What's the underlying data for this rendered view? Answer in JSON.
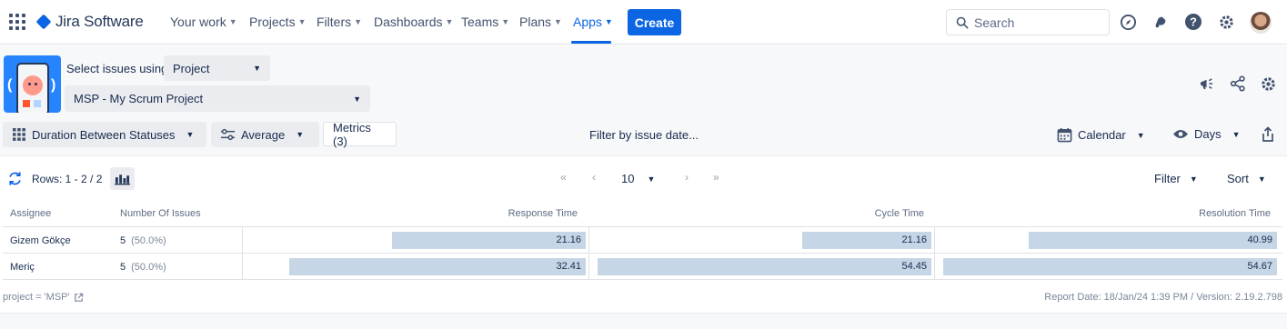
{
  "nav": {
    "brand": "Jira Software",
    "items": [
      {
        "label": "Your work"
      },
      {
        "label": "Projects"
      },
      {
        "label": "Filters"
      },
      {
        "label": "Dashboards"
      },
      {
        "label": "Teams"
      },
      {
        "label": "Plans"
      },
      {
        "label": "Apps",
        "active": true
      }
    ],
    "create_label": "Create",
    "search_placeholder": "Search",
    "accent_color": "#0c66e4"
  },
  "header": {
    "select_label": "Select issues using",
    "select_type": "Project",
    "project": "MSP - My Scrum Project"
  },
  "toolbar": {
    "report_type": "Duration Between Statuses",
    "aggregation": "Average",
    "metrics": "Metrics (3)",
    "filter_date": "Filter by issue date...",
    "calendar": "Calendar",
    "time_unit": "Days"
  },
  "rows_bar": {
    "rows_text": "Rows: 1 - 2 / 2",
    "page_size": "10",
    "filter": "Filter",
    "sort": "Sort"
  },
  "table": {
    "columns": [
      "Assignee",
      "Number Of Issues",
      "Response Time",
      "Cycle Time",
      "Resolution Time"
    ],
    "rows": [
      {
        "assignee": "Gizem Gökçe",
        "issues": "5",
        "pct": "(50.0%)",
        "response": "21.16",
        "response_frac": 0.567,
        "cycle": "21.16",
        "cycle_frac": 0.381,
        "resolution": "40.99",
        "resolution_frac": 0.73
      },
      {
        "assignee": "Meriç",
        "issues": "5",
        "pct": "(50.0%)",
        "response": "32.41",
        "response_frac": 0.868,
        "cycle": "54.45",
        "cycle_frac": 0.98,
        "resolution": "54.67",
        "resolution_frac": 0.98
      }
    ]
  },
  "footer": {
    "query": "project = 'MSP'",
    "report_info": "Report Date: 18/Jan/24 1:39 PM / Version: 2.19.2.798"
  }
}
